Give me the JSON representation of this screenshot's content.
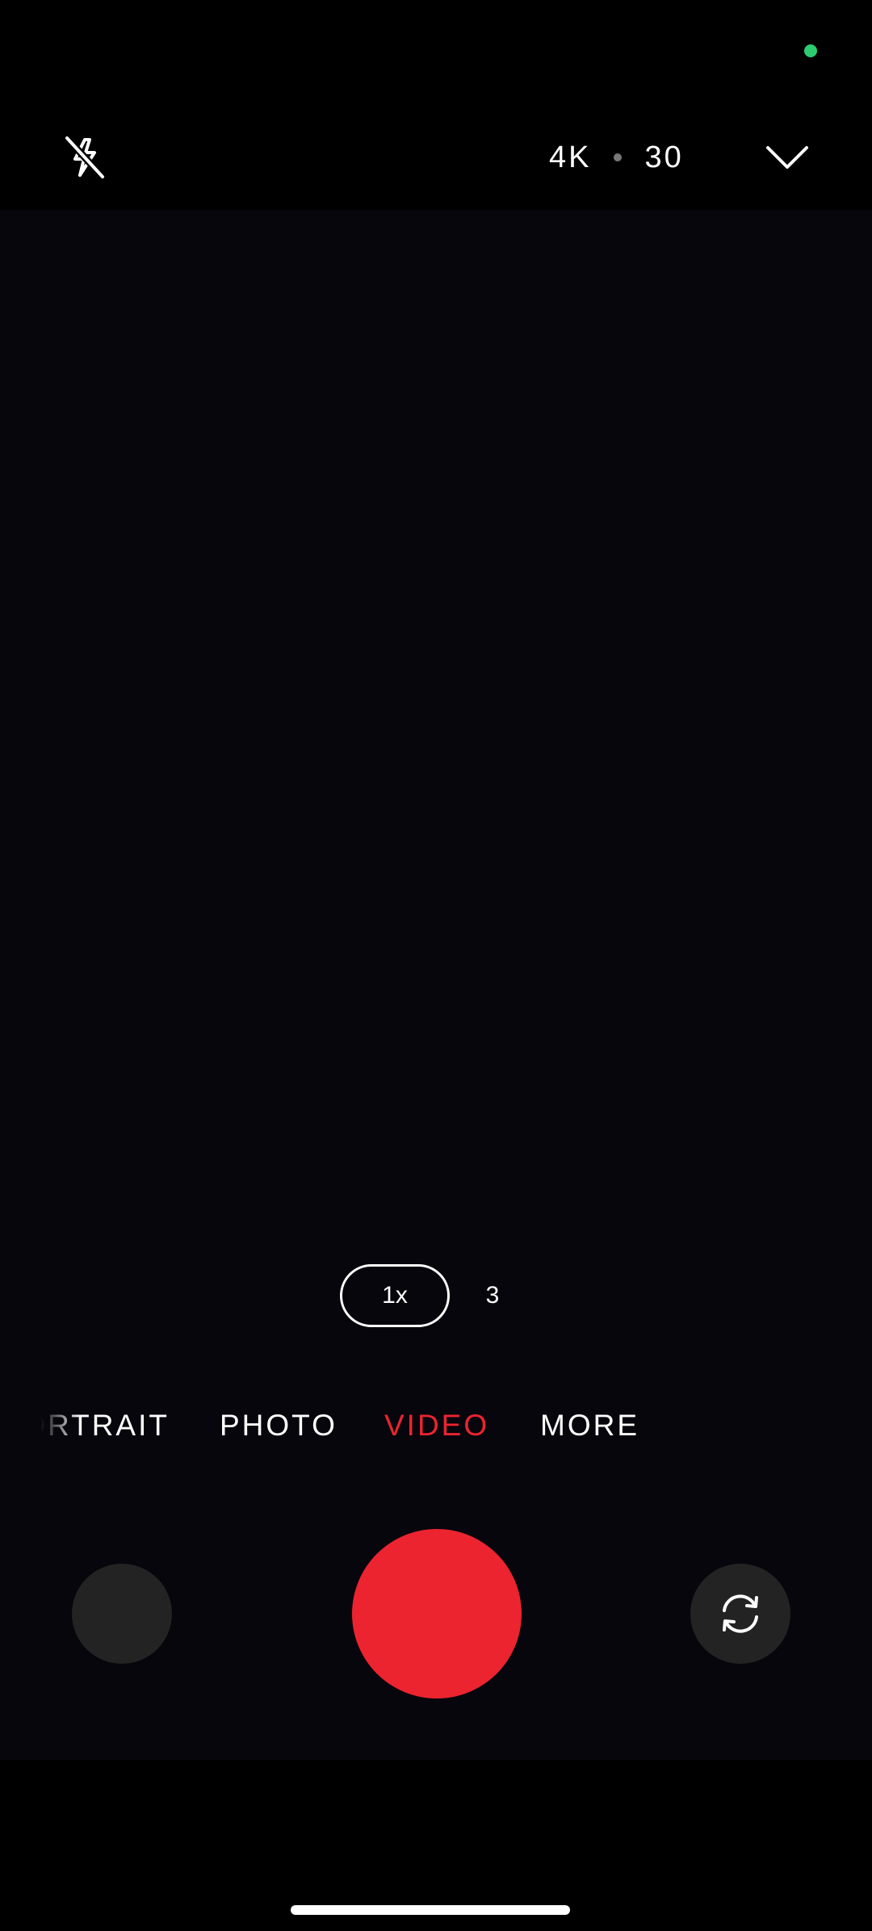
{
  "status_bar": {
    "privacy_indicator_color": "#2ecc71"
  },
  "top_bar": {
    "flash_icon": "flash-off-icon",
    "resolution": "4K",
    "frame_rate": "30",
    "expand_icon": "chevron-down-icon"
  },
  "zoom": {
    "options": [
      "1x",
      "3"
    ],
    "selected": "1x"
  },
  "modes": {
    "items": [
      "PORTRAIT",
      "PHOTO",
      "VIDEO",
      "MORE"
    ],
    "selected": "VIDEO"
  },
  "controls": {
    "gallery_icon": "gallery-thumbnail",
    "shutter_icon": "record-button",
    "switch_icon": "camera-switch-icon"
  },
  "colors": {
    "accent": "#ec2430",
    "viewfinder_bg": "#07060c",
    "control_bg": "#232323"
  }
}
